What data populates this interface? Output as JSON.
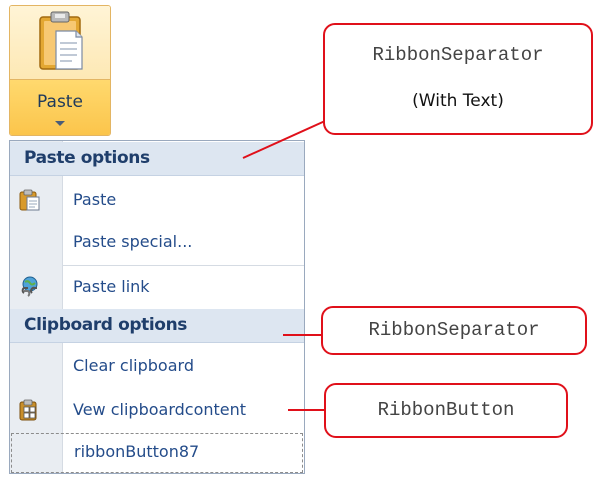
{
  "paste_button": {
    "label": "Paste",
    "icon": "clipboard-paste-icon",
    "dropdown_icon": "dropdown-arrow-icon"
  },
  "menu": {
    "sections": [
      {
        "header": "Paste options",
        "items": [
          {
            "label": "Paste",
            "icon": "paste-icon"
          },
          {
            "label": "Paste special...",
            "icon": ""
          },
          {
            "label": "Paste link",
            "icon": "paste-link-icon"
          }
        ]
      },
      {
        "header": "Clipboard options",
        "items": [
          {
            "label": "Clear clipboard",
            "icon": ""
          },
          {
            "label": "Vew clipboardcontent",
            "icon": "clipboard-view-icon"
          },
          {
            "label": "ribbonButton87",
            "icon": ""
          }
        ]
      }
    ]
  },
  "callouts": {
    "separator_with_text": {
      "title": "RibbonSeparator",
      "subtitle": "(With Text)"
    },
    "separator": {
      "title": "RibbonSeparator"
    },
    "button": {
      "title": "RibbonButton"
    }
  },
  "colors": {
    "callout_border": "#e0101a",
    "header_text": "#1f3e6b",
    "item_text": "#244c8a",
    "paste_hover": "#fbc44a"
  }
}
